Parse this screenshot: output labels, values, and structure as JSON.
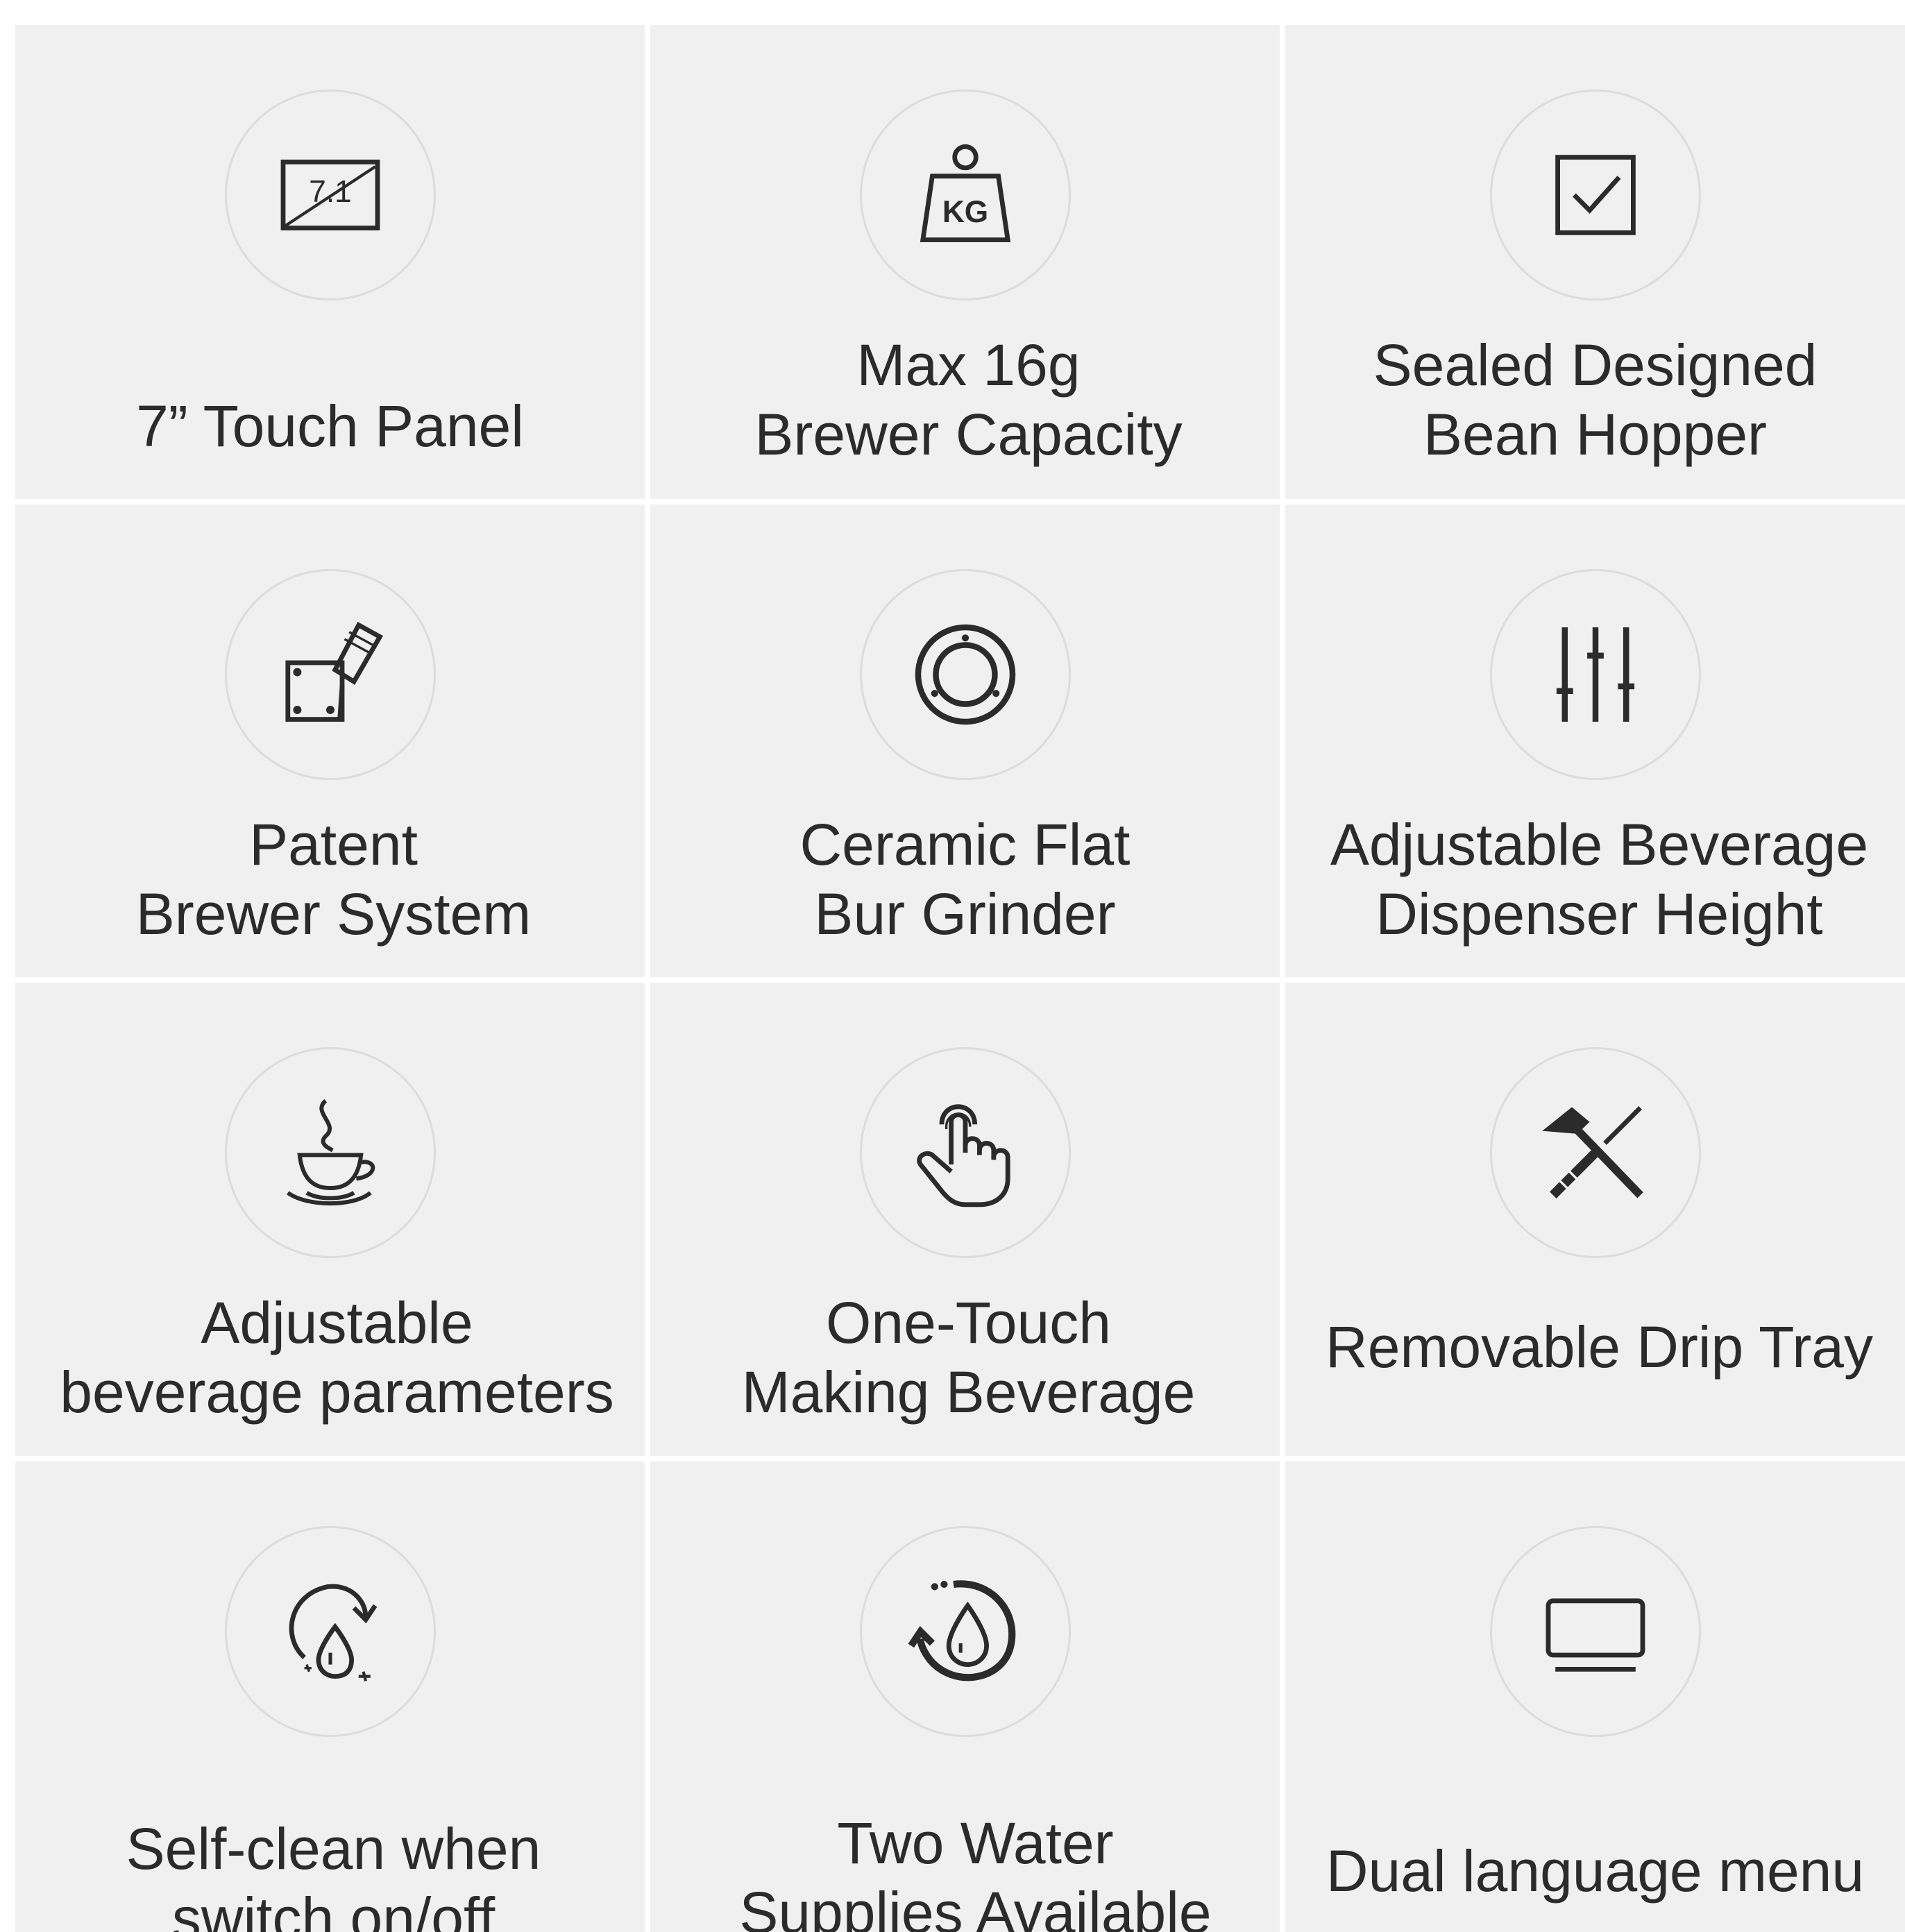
{
  "features": [
    {
      "icon": "touch-panel-icon",
      "lines": [
        "7” Touch Panel"
      ],
      "icon_text": "7.1"
    },
    {
      "icon": "kg-weight-icon",
      "lines": [
        "Max 16g",
        "Brewer Capacity"
      ],
      "icon_text": "KG"
    },
    {
      "icon": "checkbox-icon",
      "lines": [
        "Sealed Designed",
        "Bean Hopper"
      ]
    },
    {
      "icon": "brewer-system-icon",
      "lines": [
        "Patent",
        "Brewer System"
      ]
    },
    {
      "icon": "grinder-burr-icon",
      "lines": [
        "Ceramic Flat",
        "Bur Grinder"
      ]
    },
    {
      "icon": "sliders-icon",
      "lines": [
        "Adjustable Beverage",
        "Dispenser Height"
      ]
    },
    {
      "icon": "steaming-cup-icon",
      "lines": [
        "Adjustable",
        "beverage parameters"
      ]
    },
    {
      "icon": "pointing-hand-icon",
      "lines": [
        "One-Touch",
        "Making Beverage"
      ]
    },
    {
      "icon": "hammer-screwdriver-icon",
      "lines": [
        "Removable Drip Tray"
      ]
    },
    {
      "icon": "self-clean-drop-icon",
      "lines": [
        "Self-clean when",
        "switch on/off"
      ]
    },
    {
      "icon": "water-cycle-icon",
      "lines": [
        "Two Water",
        "Supplies Available"
      ]
    },
    {
      "icon": "monitor-icon",
      "lines": [
        "Dual language menu"
      ]
    }
  ],
  "colors": {
    "cell_bg": "#f0f0f0",
    "circle_border": "#dcdcdc",
    "icon": "#2b2b2b",
    "text": "#2b2b2b"
  }
}
